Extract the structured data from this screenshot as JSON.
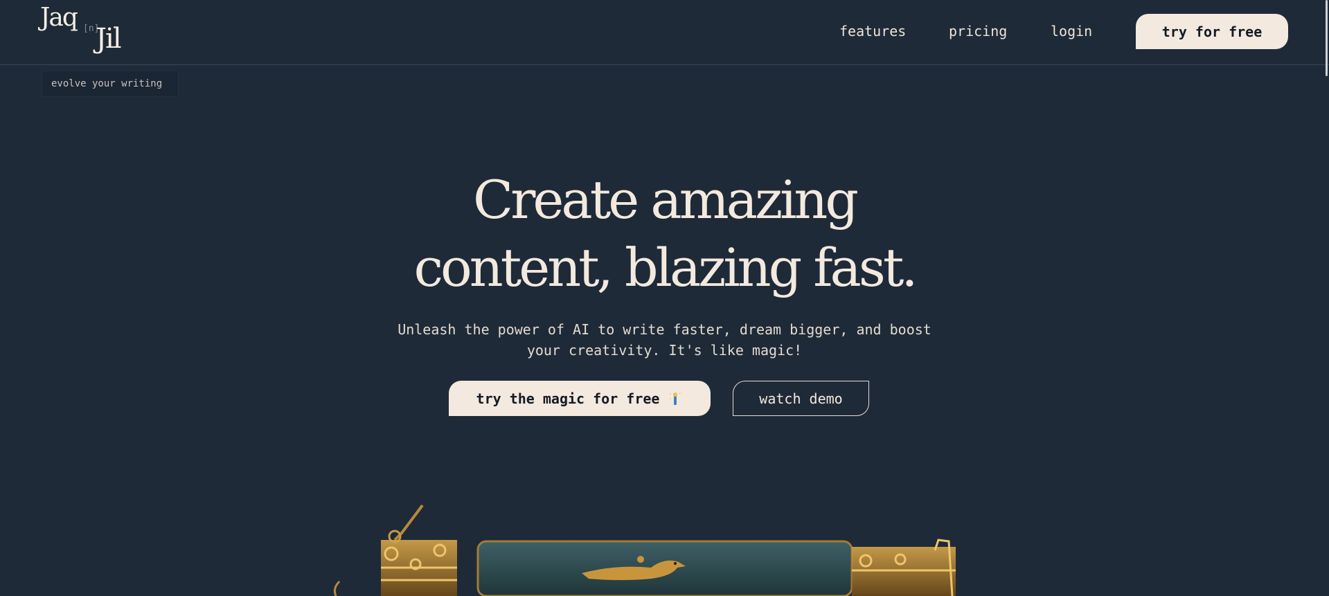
{
  "brand": {
    "word1": "Jaq",
    "connector": "[n]",
    "word2": "Jil",
    "tagline": "evolve your writing"
  },
  "nav": {
    "features": "features",
    "pricing": "pricing",
    "login": "login",
    "cta": "try for free"
  },
  "hero": {
    "title_line1": "Create amazing",
    "title_line2": "content, blazing fast.",
    "subtitle_line1": "Unleash the power of AI to write faster, dream bigger, and boost",
    "subtitle_line2": "your creativity. It's like magic!",
    "primary_cta": "try the magic for free",
    "primary_cta_icon": "magic-wand-icon",
    "secondary_cta": "watch demo"
  },
  "colors": {
    "background": "#1e2a38",
    "cream": "#f3e9de",
    "button_text": "#141b24"
  }
}
